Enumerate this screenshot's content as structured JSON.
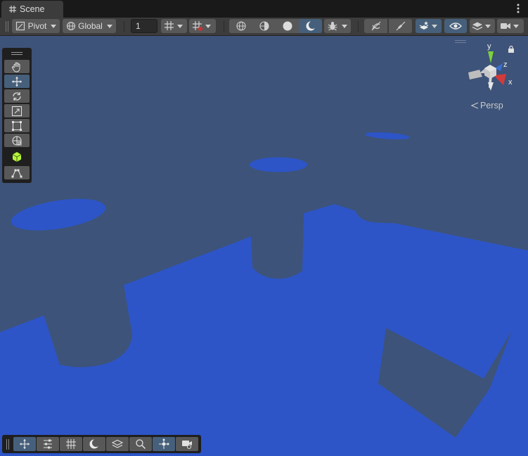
{
  "window": {
    "tab_title": "Scene",
    "tab_icon": "grid-icon",
    "menu_icon": "kebab-menu-icon"
  },
  "toolbar": {
    "pivot_label": "Pivot",
    "global_label": "Global",
    "grid_snap_value": "1",
    "buttons": [
      {
        "name": "grid-snapping-toggle",
        "icon": "grid-snap-icon",
        "has_dropdown": true
      },
      {
        "name": "grid-visibility-toggle",
        "icon": "grid-icon",
        "has_dropdown": true
      },
      {
        "name": "wireframe-draw-mode",
        "icon": "wireframe-sphere-icon"
      },
      {
        "name": "shaded-wireframe-mode",
        "icon": "half-sphere-icon"
      },
      {
        "name": "shaded-draw-mode",
        "icon": "solid-sphere-icon"
      },
      {
        "name": "lighting-toggle",
        "icon": "moon-icon",
        "active": true
      },
      {
        "name": "debug-draw-mode",
        "icon": "bug-icon",
        "has_dropdown": true
      },
      {
        "name": "2d-toggle",
        "icon": "no-2d-icon"
      },
      {
        "name": "audio-toggle",
        "icon": "mute-icon"
      },
      {
        "name": "effects-toggle",
        "icon": "layers-star-icon",
        "active": true,
        "has_dropdown": true
      },
      {
        "name": "scene-visibility-toggle",
        "icon": "eye-icon",
        "active": true
      },
      {
        "name": "layers-dropdown",
        "icon": "layers-icon",
        "has_dropdown": true
      },
      {
        "name": "camera-dropdown",
        "icon": "camera-icon",
        "has_dropdown": true
      }
    ]
  },
  "tools": [
    {
      "name": "view-tool",
      "icon": "hand-icon"
    },
    {
      "name": "move-tool",
      "icon": "move-arrows-icon",
      "active": true
    },
    {
      "name": "rotate-tool",
      "icon": "rotate-icon"
    },
    {
      "name": "scale-tool",
      "icon": "scale-icon"
    },
    {
      "name": "rect-tool",
      "icon": "rect-icon"
    },
    {
      "name": "transform-tool",
      "icon": "transform-icon"
    },
    {
      "name": "custom-tool",
      "icon": "green-cube-icon"
    },
    {
      "name": "probuilder-tool",
      "icon": "vertex-edit-icon"
    }
  ],
  "gizmo": {
    "y_label": "y",
    "z_label": "z",
    "x_label": "x",
    "projection_label": "Persp",
    "colors": {
      "y": "#7fd13b",
      "z": "#3b6fd1",
      "x": "#d13b3b"
    }
  },
  "overlays": [
    {
      "name": "overlay-move",
      "icon": "move-arrows-icon",
      "active": true
    },
    {
      "name": "overlay-settings",
      "icon": "sliders-icon"
    },
    {
      "name": "overlay-grid",
      "icon": "grid-icon"
    },
    {
      "name": "overlay-lighting",
      "icon": "moon-icon"
    },
    {
      "name": "overlay-layers",
      "icon": "layers-icon"
    },
    {
      "name": "overlay-search",
      "icon": "search-icon"
    },
    {
      "name": "overlay-orientation",
      "icon": "orientation-icon",
      "active": true
    },
    {
      "name": "overlay-camera",
      "icon": "camera-icon"
    }
  ],
  "colors": {
    "sky": "#3d5379",
    "ground": "#2d55c8",
    "shadow": "#3d5379",
    "accent_active": "#46607c"
  }
}
